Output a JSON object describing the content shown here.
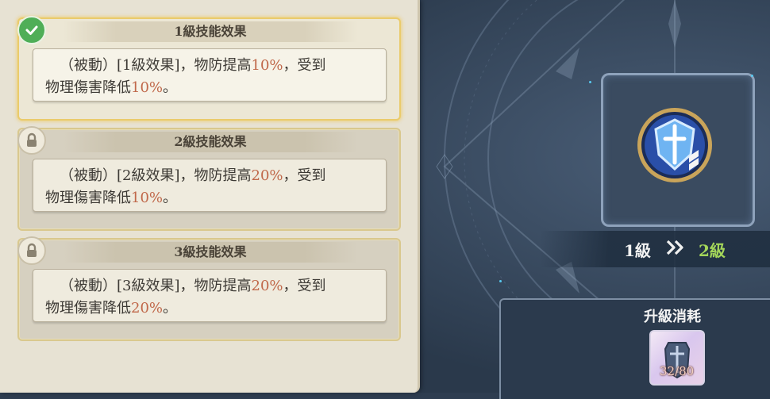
{
  "skill_levels": [
    {
      "header": "1級技能效果",
      "status": "unlocked",
      "line1_prefix": "（被動）[1級效果]，物防提高",
      "line1_value": "10%",
      "line1_suffix": "，受到",
      "line2_prefix": "物理傷害降低",
      "line2_value": "10%",
      "line2_suffix": "。"
    },
    {
      "header": "2級技能效果",
      "status": "locked",
      "line1_prefix": "（被動）[2級效果]，物防提高",
      "line1_value": "20%",
      "line1_suffix": "，受到",
      "line2_prefix": "物理傷害降低",
      "line2_value": "10%",
      "line2_suffix": "。"
    },
    {
      "header": "3級技能效果",
      "status": "locked",
      "line1_prefix": "（被動）[3級效果]，物防提高",
      "line1_value": "20%",
      "line1_suffix": "，受到",
      "line2_prefix": "物理傷害降低",
      "line2_value": "20%",
      "line2_suffix": "。"
    }
  ],
  "upgrade": {
    "current_level": "1級",
    "next_level": "2級",
    "cost_title": "升級消耗",
    "cost_count": "32/80"
  },
  "colors": {
    "highlight": "#c0684a",
    "next_level": "#a4d65a",
    "check_badge": "#4fae57"
  },
  "icons": [
    "check-icon",
    "lock-icon",
    "skill-shield-icon",
    "double-chevron-right-icon",
    "material-item-icon"
  ]
}
